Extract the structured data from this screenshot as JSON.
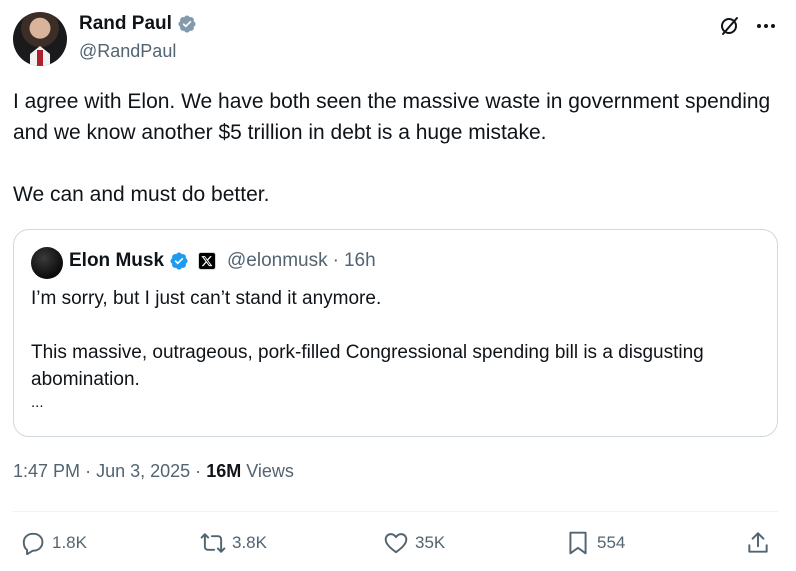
{
  "author": {
    "name": "Rand Paul",
    "handle": "@RandPaul"
  },
  "tweet": {
    "text_line1": "I agree with Elon.  We have both seen the massive waste in government spending and we know another $5 trillion in debt is a huge mistake.",
    "text_line2": "We can and must do better."
  },
  "quote": {
    "name": "Elon Musk",
    "handle": "@elonmusk",
    "separator": "·",
    "time": "16h",
    "text_line1": "I’m sorry, but I just can’t stand it anymore.",
    "text_line2": "This massive, outrageous, pork-filled Congressional spending bill is a disgusting abomination.",
    "text_line3": "..."
  },
  "meta": {
    "time": "1:47 PM",
    "dot": "·",
    "date": "Jun 3, 2025",
    "views_count": "16M",
    "views_label": "Views"
  },
  "actions": {
    "replies": "1.8K",
    "reposts": "3.8K",
    "likes": "35K",
    "bookmarks": "554"
  },
  "colors": {
    "verified_blue": "#1d9bf0",
    "verified_gray": "#829aab",
    "secondary_text": "#536471",
    "primary_text": "#0f1419",
    "border": "#cfd9de"
  },
  "icons": [
    "verified-badge-icon",
    "grok-icon",
    "more-icon",
    "x-badge-icon",
    "reply-icon",
    "repost-icon",
    "like-icon",
    "bookmark-icon",
    "share-icon"
  ]
}
